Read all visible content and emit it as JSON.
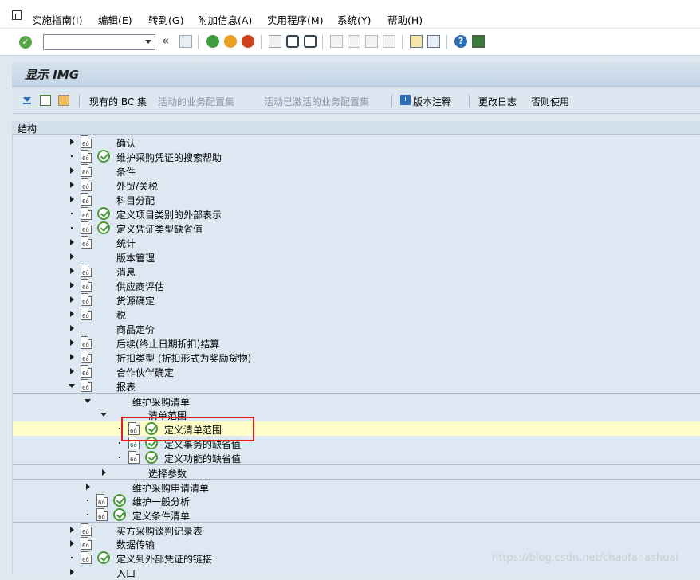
{
  "menubar": {
    "items": [
      "实施指南(I)",
      "编辑(E)",
      "转到(G)",
      "附加信息(A)",
      "实用程序(M)",
      "系统(Y)",
      "帮助(H)"
    ]
  },
  "toolbar": {
    "command_value": "",
    "icons": [
      "ok-icon",
      "back-double-icon",
      "save-icon",
      "back-icon",
      "exit-icon",
      "cancel-icon",
      "print-icon",
      "find-icon",
      "find-next-icon",
      "first-page-icon",
      "prev-page-icon",
      "next-page-icon",
      "last-page-icon",
      "new-session-icon",
      "shortcut-icon",
      "help-icon",
      "customize-icon"
    ]
  },
  "title": "显示 IMG",
  "apptoolbar": {
    "existing_bc": "现有的 BC 集",
    "active_bc": "活动的业务配置集",
    "active_bc_activated": "活动已激活的业务配置集",
    "release_notes": "版本注释",
    "change_log": "更改日志",
    "else_use": "否则使用"
  },
  "tree": {
    "header": "结构",
    "rows": [
      {
        "label": "确认",
        "level": 0,
        "node": "closed",
        "doc": true,
        "act": false
      },
      {
        "label": "维护采购凭证的搜索帮助",
        "level": 0,
        "node": "leaf",
        "doc": true,
        "act": true
      },
      {
        "label": "条件",
        "level": 0,
        "node": "closed",
        "doc": true,
        "act": false
      },
      {
        "label": "外贸/关税",
        "level": 0,
        "node": "closed",
        "doc": true,
        "act": false
      },
      {
        "label": "科目分配",
        "level": 0,
        "node": "closed",
        "doc": true,
        "act": false
      },
      {
        "label": "定义项目类别的外部表示",
        "level": 0,
        "node": "leaf",
        "doc": true,
        "act": true
      },
      {
        "label": "定义凭证类型缺省值",
        "level": 0,
        "node": "leaf",
        "doc": true,
        "act": true
      },
      {
        "label": "统计",
        "level": 0,
        "node": "closed",
        "doc": true,
        "act": false
      },
      {
        "label": "版本管理",
        "level": 0,
        "node": "closed",
        "doc": false,
        "act": false
      },
      {
        "label": "消息",
        "level": 0,
        "node": "closed",
        "doc": true,
        "act": false
      },
      {
        "label": "供应商评估",
        "level": 0,
        "node": "closed",
        "doc": true,
        "act": false
      },
      {
        "label": "货源确定",
        "level": 0,
        "node": "closed",
        "doc": true,
        "act": false
      },
      {
        "label": "税",
        "level": 0,
        "node": "closed",
        "doc": true,
        "act": false
      },
      {
        "label": "商品定价",
        "level": 0,
        "node": "closed",
        "doc": false,
        "act": false
      },
      {
        "label": "后续(终止日期折扣)结算",
        "level": 0,
        "node": "closed",
        "doc": true,
        "act": false
      },
      {
        "label": "折扣类型 (折扣形式为奖励货物)",
        "level": 0,
        "node": "closed",
        "doc": true,
        "act": false
      },
      {
        "label": "合作伙伴确定",
        "level": 0,
        "node": "closed",
        "doc": true,
        "act": false
      },
      {
        "label": "报表",
        "level": 0,
        "node": "open",
        "doc": true,
        "act": false
      },
      {
        "label": "维护采购清单",
        "level": 1,
        "node": "open",
        "doc": false,
        "act": false,
        "sep": true
      },
      {
        "label": "清单范围",
        "level": 2,
        "node": "open",
        "doc": false,
        "act": false
      },
      {
        "label": "定义清单范围",
        "level": 3,
        "node": "leaf",
        "doc": true,
        "act": true,
        "hl": true
      },
      {
        "label": "定义事务的缺省值",
        "level": 3,
        "node": "leaf",
        "doc": true,
        "act": true
      },
      {
        "label": "定义功能的缺省值",
        "level": 3,
        "node": "leaf",
        "doc": true,
        "act": true
      },
      {
        "label": "选择参数",
        "level": 2,
        "node": "closed",
        "doc": false,
        "act": false,
        "sep": true
      },
      {
        "label": "维护采购申请清单",
        "level": 1,
        "node": "closed",
        "doc": false,
        "act": false,
        "sep": true
      },
      {
        "label": "维护一般分析",
        "level": 1,
        "node": "leaf",
        "doc": true,
        "act": true
      },
      {
        "label": "定义条件清单",
        "level": 1,
        "node": "leaf",
        "doc": true,
        "act": true
      },
      {
        "label": "买方采购谈判记录表",
        "level": 0,
        "node": "closed",
        "doc": true,
        "act": false,
        "sep": true
      },
      {
        "label": "数据传输",
        "level": 0,
        "node": "closed",
        "doc": true,
        "act": false
      },
      {
        "label": "定义到外部凭证的链接",
        "level": 0,
        "node": "leaf",
        "doc": true,
        "act": true
      },
      {
        "label": "入口",
        "level": 0,
        "node": "closed",
        "doc": false,
        "act": false
      }
    ]
  },
  "watermark": "https://blog.csdn.net/chaofanashuai"
}
